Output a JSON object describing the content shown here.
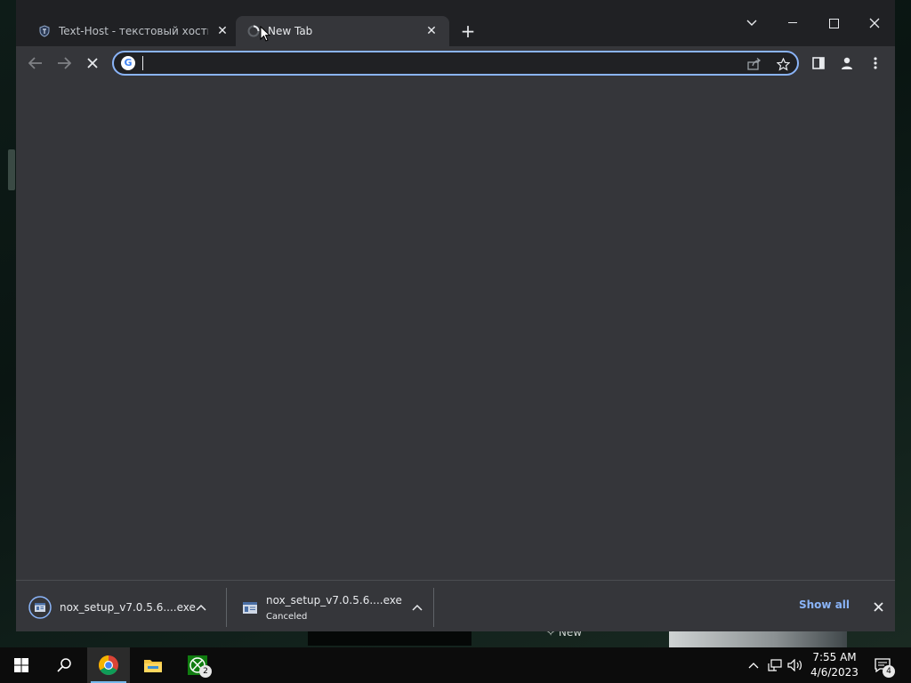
{
  "browser": {
    "tabs": [
      {
        "title": "Text-Host - текстовый хостинг",
        "active": false,
        "favicon": "text-host-shield-icon"
      },
      {
        "title": "New Tab",
        "active": true,
        "loading": true,
        "favicon": "loading-spinner-icon"
      }
    ],
    "omnibox": {
      "value": "",
      "placeholder": ""
    }
  },
  "downloads": {
    "items": [
      {
        "filename": "nox_setup_v7.0.5.6....exe",
        "status": ""
      },
      {
        "filename": "nox_setup_v7.0.5.6....exe",
        "status": "Canceled"
      }
    ],
    "show_all_label": "Show all"
  },
  "desktop": {
    "new_label": "New"
  },
  "taskbar": {
    "xbox_badge": "2",
    "clock_time": "7:55 AM",
    "clock_date": "4/6/2023",
    "notification_count": "4"
  },
  "colors": {
    "accent": "#8ab4f8",
    "toolbar_bg": "#35363a",
    "frame_bg": "#202124",
    "taskbar_bg": "#0c0c0c"
  }
}
